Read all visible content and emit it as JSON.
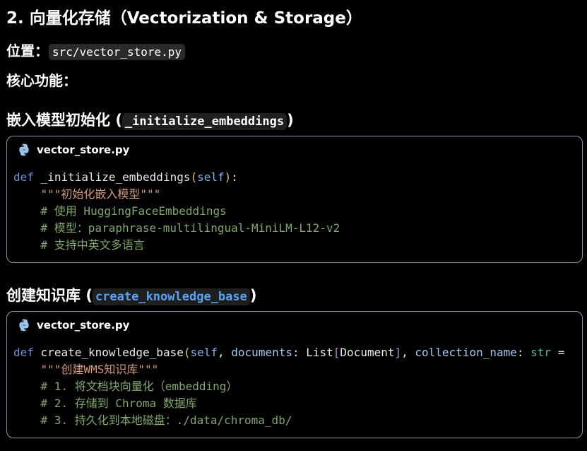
{
  "section": {
    "title": "2. 向量化存储（Vectorization & Storage）",
    "location_label": "位置：",
    "location_path": "src/vector_store.py",
    "core_label": "核心功能："
  },
  "subsections": [
    {
      "title": "嵌入模型初始化",
      "fn_name": "_initialize_embeddings",
      "file": "vector_store.py",
      "code": {
        "def": "def",
        "name": "_initialize_embeddings",
        "self": "self",
        "docstring": "\"\"\"初始化嵌入模型\"\"\"",
        "comments": [
          "# 使用 HuggingFaceEmbeddings",
          "# 模型：paraphrase-multilingual-MiniLM-L12-v2",
          "# 支持中英文多语言"
        ]
      }
    },
    {
      "title": "创建知识库",
      "fn_name": "create_knowledge_base",
      "file": "vector_store.py",
      "code": {
        "def": "def",
        "name": "create_knowledge_base",
        "self": "self",
        "param1": "documents",
        "type1": "List",
        "type1_inner": "Document",
        "param2": "collection_name",
        "type2": "str",
        "docstring": "\"\"\"创建WMS知识库\"\"\"",
        "comments": [
          "# 1. 将文档块向量化（embedding）",
          "# 2. 存储到 Chroma 数据库",
          "# 3. 持久化到本地磁盘：./data/chroma_db/"
        ]
      }
    }
  ]
}
